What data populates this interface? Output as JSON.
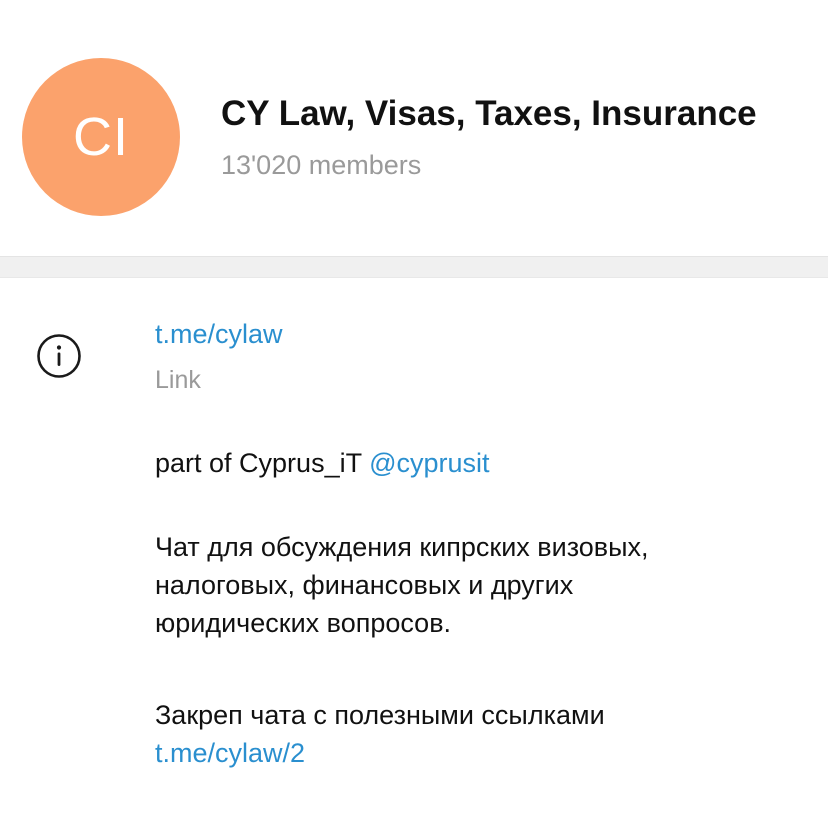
{
  "header": {
    "avatar_initials": "CI",
    "avatar_color": "#fba26c",
    "title": "CY Law, Visas, Taxes, Insurance",
    "members": "13'020 members"
  },
  "info": {
    "icon": "info-icon",
    "link": "t.me/cylaw",
    "link_caption": "Link",
    "description": {
      "line1_text": "part of Cyprus_iT ",
      "line1_mention": "@cyprusit",
      "para2_line1": "Чат для обсуждения кипрских визовых,",
      "para2_line2": "налоговых, финансовых и других",
      "para2_line3": "юридических вопросов.",
      "para3_line1": "Закреп чата с полезными ссылками",
      "para3_link": "t.me/cylaw/2"
    }
  },
  "colors": {
    "link": "#2a8fcf",
    "muted": "#9a9a9a",
    "text": "#111111"
  }
}
